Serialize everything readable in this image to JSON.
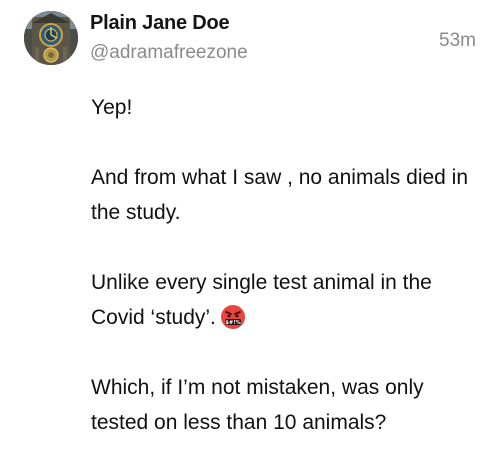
{
  "post": {
    "author": {
      "display_name": "Plain Jane Doe",
      "handle": "@adramafreezone",
      "avatar_icon": "clock-tower-avatar"
    },
    "timestamp": "53m",
    "paragraphs": [
      {
        "text": "Yep!"
      },
      {
        "text": "And from what I saw , no animals died in the study."
      },
      {
        "text": "Unlike every single test animal in the Covid ‘study’.",
        "emoji": "face-with-symbols-on-mouth-icon"
      },
      {
        "text": "Which, if I’m not mistaken, was only tested on less than 10 animals?"
      }
    ]
  },
  "colors": {
    "text": "#111111",
    "muted": "#8a8a8a",
    "emoji": "#e8453c",
    "background": "#ffffff"
  }
}
